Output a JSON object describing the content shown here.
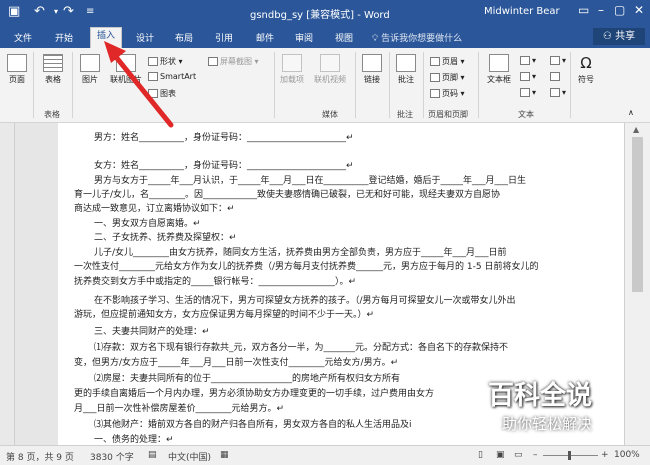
{
  "titlebar": {
    "document_title": "gsndbg_sy [兼容模式] - Word",
    "user": "Midwinter Bear",
    "icons": [
      "save-icon",
      "undo-icon",
      "redo-icon",
      "customize-icon"
    ]
  },
  "tabs": {
    "file": "文件",
    "home": "开始",
    "insert": "插入",
    "design": "设计",
    "layout": "布局",
    "references": "引用",
    "mailings": "邮件",
    "review": "审阅",
    "view": "视图",
    "tell_me": "告诉我你想要做什么",
    "share": "共享"
  },
  "ribbon": {
    "pages": "页面",
    "table": "表格",
    "picture": "图片",
    "online_picture": "联机图片",
    "shapes": "形状",
    "smartart": "SmartArt",
    "chart": "图表",
    "screenshot": "屏幕截图",
    "addins": "加载项",
    "online_video": "联机视频",
    "link": "链接",
    "comment": "批注",
    "header": "页眉",
    "footer": "页脚",
    "page_number": "页码",
    "textbox": "文本框",
    "symbol": "符号",
    "groups": {
      "tables": "表格",
      "media": "媒体",
      "comments": "批注",
      "header_footer": "页眉和页脚",
      "text": "文本"
    }
  },
  "document": {
    "lines": [
      "男方：姓名__________，身份证号码：______________________↵",
      "",
      "女方：姓名__________，身份证号码：______________________↵",
      "男方与女方于_____年___月认识，于_____年___月___日在__________登记结婚，婚后于_____年___月___日生",
      "育一儿子/女儿，名________。因____________致使夫妻感情确已破裂，已无和好可能，现经夫妻双方自愿协",
      "商达成一致意见，订立离婚协议如下：↵",
      "一、男女双方自愿离婚。↵",
      "二、子女抚养、抚养费及探望权：↵",
      "儿子/女儿________由女方抚养，随同女方生活，抚养费由男方全部负责，男方应于_____年___月___日前",
      "一次性支付________元给女方作为女儿的抚养费（/男方每月支付抚养费______元，男方应于每月的 1-5 日前将女儿的",
      "抚养费交到女方手中或指定的_____银行帐号：_________________）。↵",
      "在不影响孩子学习、生活的情况下，男方可探望女方抚养的孩子。（/男方每月可探望女儿一次或带女儿外出",
      "游玩，但应提前通知女方，女方应保证男方每月探望的时间不少于一天。）↵",
      "三、夫妻共同财产的处理：↵",
      "⑴存款：双方名下现有银行存款共_元，双方各分一半，为_______元。分配方式：各自名下的存款保持不",
      "变，但男方/女方应于_____年___月___日前一次性支付________元给女方/男方。↵",
      "⑵房屋：夫妻共同所有的位于__________________的房地产所有权归女方所有",
      "更的手续自离婚后一个月内办理，男方必须协助女方办理变更的一切手续，过户费用由女方",
      "月___日前一次性补偿房屋差价________元给男方。↵",
      "⑶其他财产：婚前双方各自的财产归各自所有，男女双方各自的私人生活用品及i",
      "一、债务的处理：↵"
    ]
  },
  "status": {
    "page": "第 8 页，共 9 页",
    "words": "3830 个字",
    "language": "中文(中国)",
    "zoom": "100%"
  },
  "watermark": {
    "main": "百科全说",
    "sub": "助你轻松解决"
  },
  "colors": {
    "accent": "#2b579a",
    "arrow": "#e02828"
  }
}
